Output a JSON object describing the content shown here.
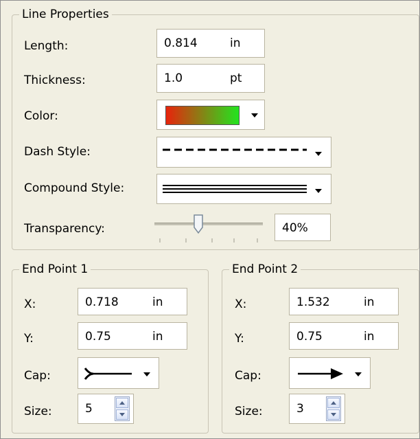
{
  "line_properties": {
    "title": "Line Properties",
    "length": {
      "label": "Length:",
      "value": "0.814",
      "unit": "in"
    },
    "thickness": {
      "label": "Thickness:",
      "value": "1.0",
      "unit": "pt"
    },
    "color": {
      "label": "Color:",
      "gradient_start": "#e8230c",
      "gradient_end": "#22e51f"
    },
    "dash_style": {
      "label": "Dash Style:",
      "icon": "dashed-line-icon"
    },
    "compound_style": {
      "label": "Compound Style:",
      "icon": "triple-line-icon"
    },
    "transparency": {
      "label": "Transparency:",
      "value": "40%",
      "slider_fraction": 0.4
    }
  },
  "end_point_1": {
    "title": "End Point 1",
    "x": {
      "label": "X:",
      "value": "0.718",
      "unit": "in"
    },
    "y": {
      "label": "Y:",
      "value": "0.75",
      "unit": "in"
    },
    "cap": {
      "label": "Cap:",
      "icon": "tail-cap-icon"
    },
    "size": {
      "label": "Size:",
      "value": "5"
    }
  },
  "end_point_2": {
    "title": "End Point 2",
    "x": {
      "label": "X:",
      "value": "1.532",
      "unit": "in"
    },
    "y": {
      "label": "Y:",
      "value": "0.75",
      "unit": "in"
    },
    "cap": {
      "label": "Cap:",
      "icon": "arrow-cap-icon"
    },
    "size": {
      "label": "Size:",
      "value": "3"
    }
  }
}
